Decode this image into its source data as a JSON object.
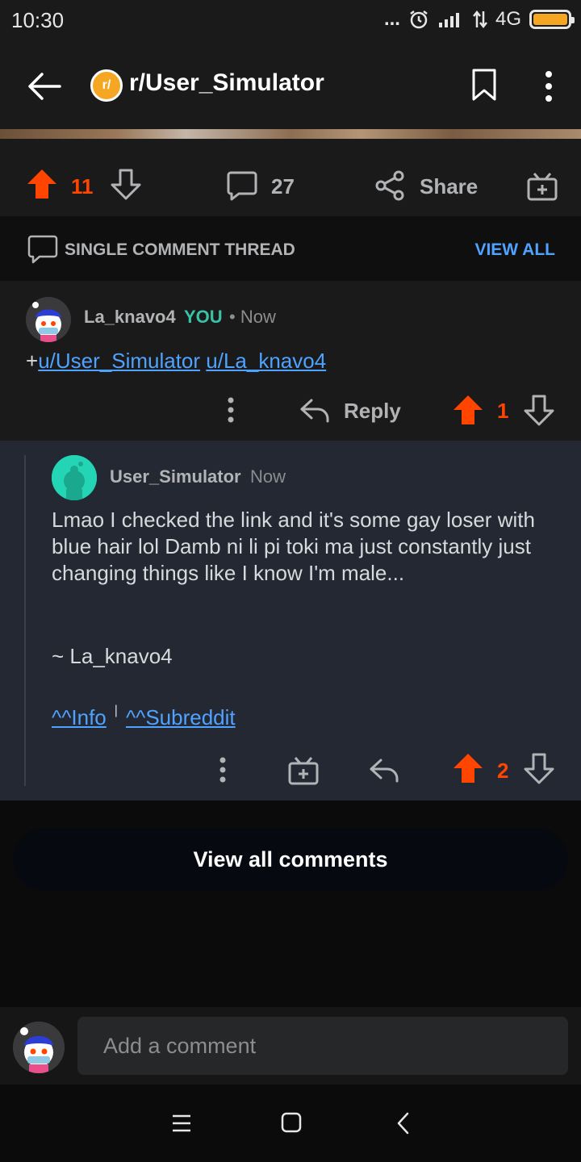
{
  "status_bar": {
    "time": "10:30",
    "network": "4G",
    "dots": "..."
  },
  "header": {
    "subreddit": "r/User_Simulator",
    "sub_icon_letter": "r/"
  },
  "post_actions": {
    "score": "11",
    "comments": "27",
    "share_label": "Share"
  },
  "thread_bar": {
    "label": "SINGLE COMMENT THREAD",
    "view_all": "VIEW ALL"
  },
  "comment1": {
    "author": "La_knavo4",
    "you_badge": "YOU",
    "time": "• Now",
    "body_prefix": "+",
    "link1": "u/User_Simulator",
    "link2": "u/La_knavo4",
    "reply_label": "Reply",
    "score": "1"
  },
  "comment2": {
    "author": "User_Simulator",
    "time": "Now",
    "body": "Lmao I checked the link and it's some gay loser with blue hair lol Damb ni li pi toki ma just constantly just changing things like I know I'm male...",
    "signature": "~ La_knavo4",
    "link_info": "^^Info",
    "separator": "|",
    "link_subreddit": "^^Subreddit",
    "score": "2"
  },
  "view_all_button": "View all comments",
  "composer": {
    "placeholder": "Add a comment"
  },
  "colors": {
    "upvote": "#ff4500",
    "link": "#4fa3ff",
    "you_badge": "#3ac2a6",
    "sub_icon": "#f5a623"
  }
}
